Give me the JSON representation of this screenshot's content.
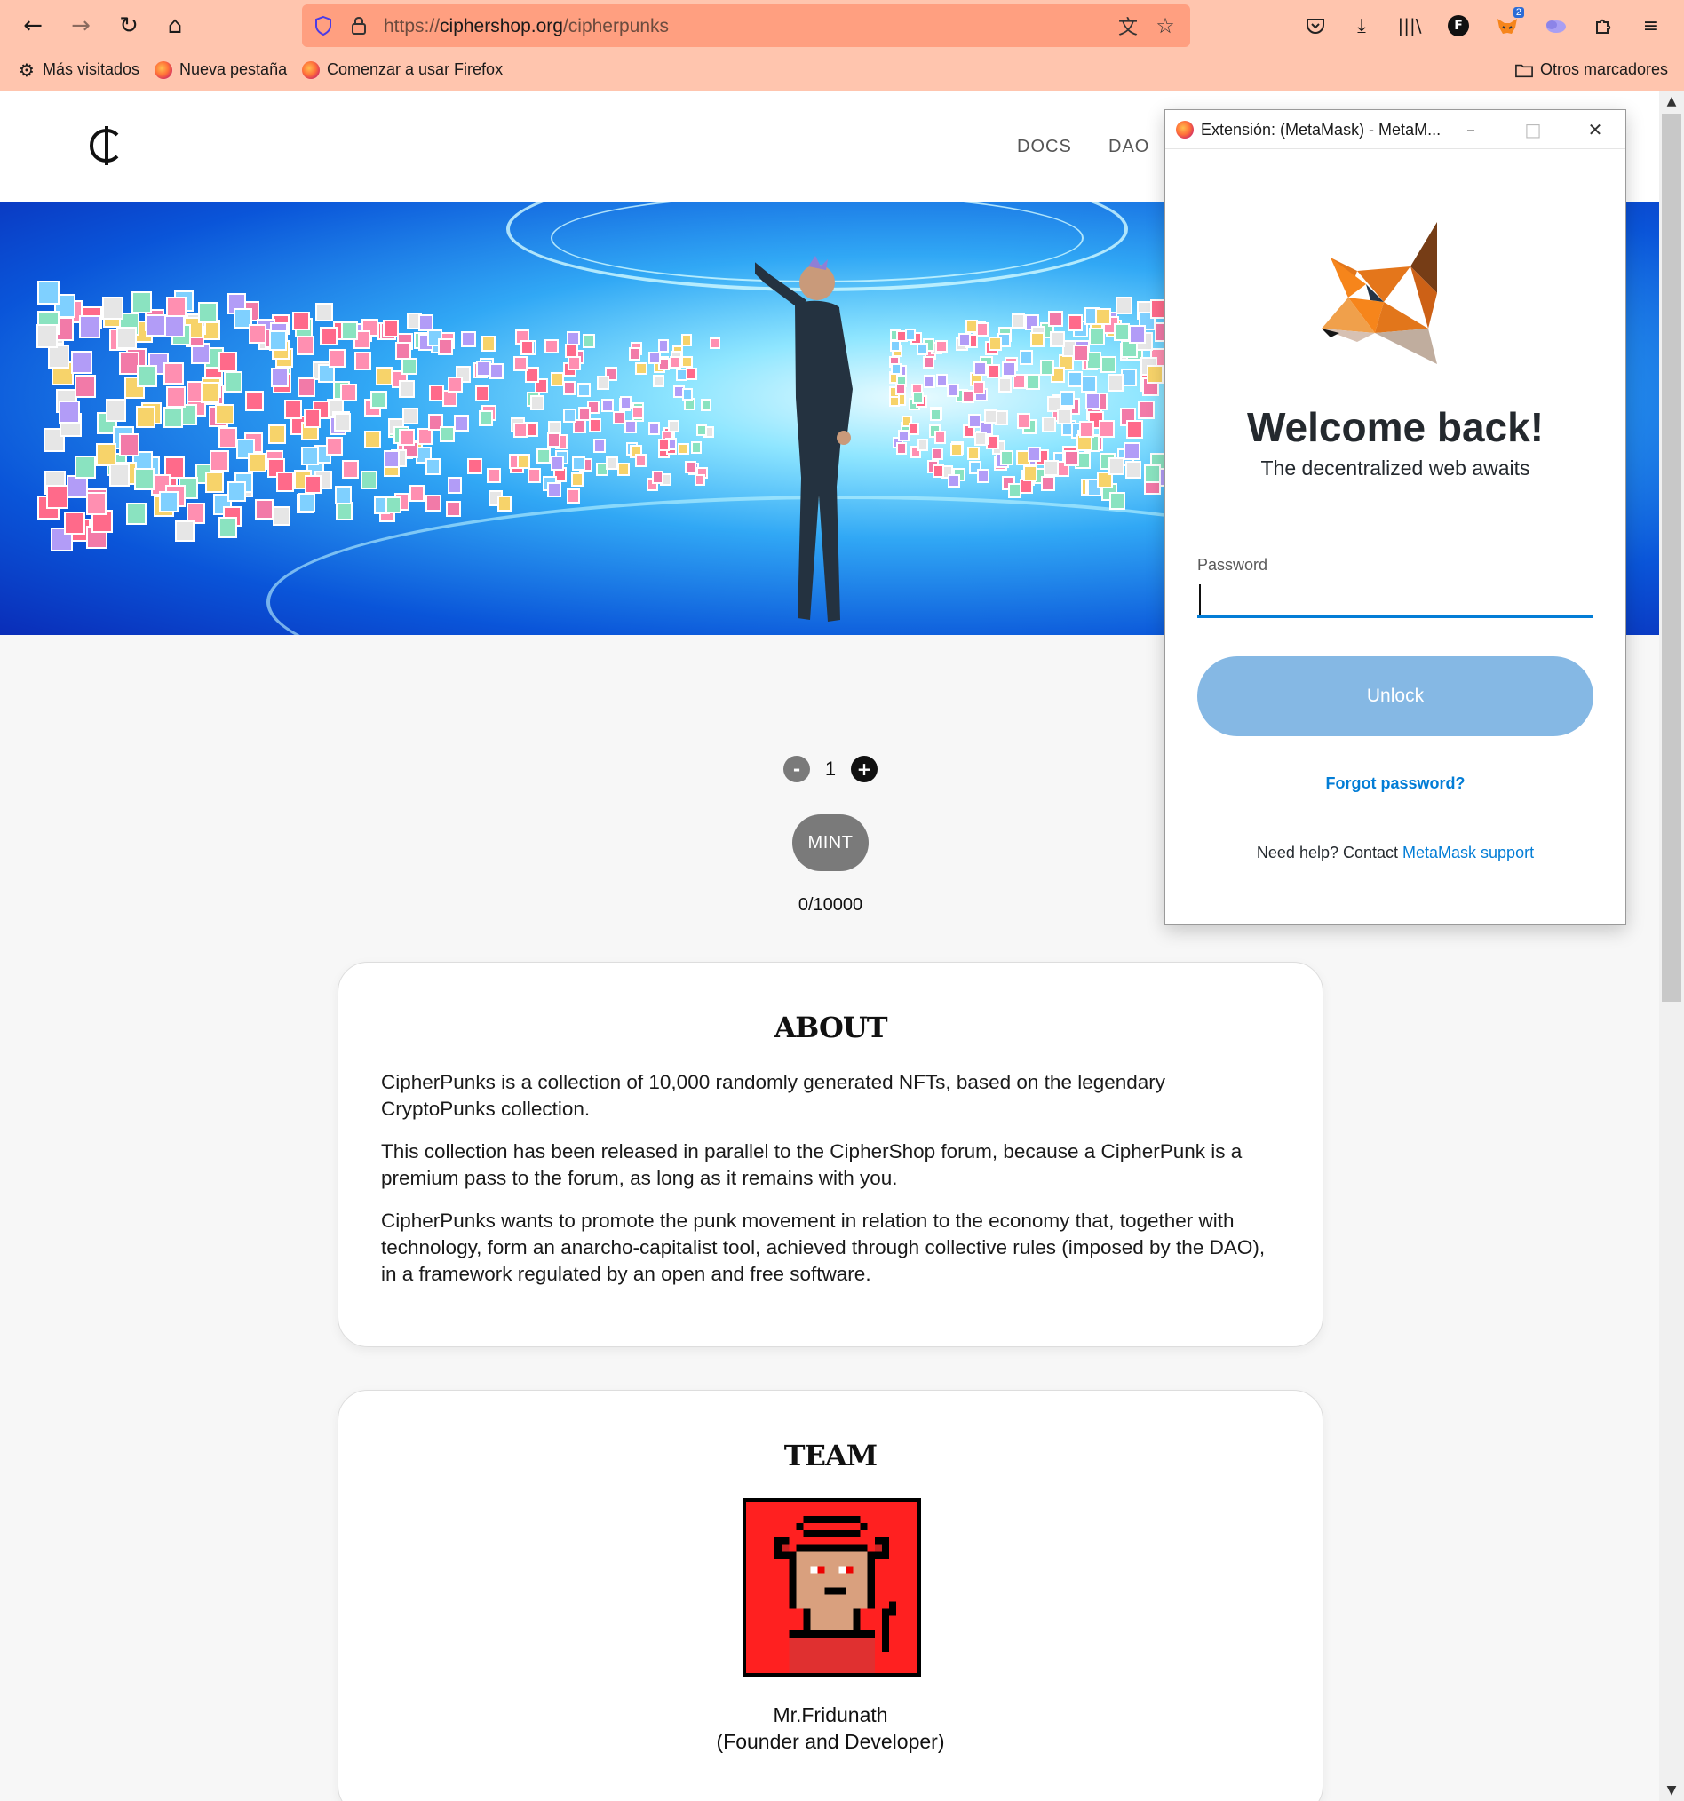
{
  "browser": {
    "url_prefix": "https://",
    "url_domain": "ciphershop.org",
    "url_path": "/cipherpunks",
    "extension_badge": "2",
    "profile_initial": "F",
    "bookmarks": [
      {
        "label": "Más visitados",
        "icon": "gear-icon"
      },
      {
        "label": "Nueva pestaña",
        "icon": "firefox-icon"
      },
      {
        "label": "Comenzar a usar Firefox",
        "icon": "firefox-icon"
      }
    ],
    "other_bookmarks": "Otros marcadores"
  },
  "site": {
    "nav": [
      "DOCS",
      "DAO"
    ],
    "mint": {
      "minus": "-",
      "quantity": "1",
      "plus": "+",
      "button": "MINT",
      "supply": "0/10000"
    },
    "about": {
      "title": "ABOUT",
      "paragraphs": [
        "CipherPunks is a collection of 10,000 randomly generated NFTs, based on the legendary CryptoPunks collection.",
        "This collection has been released in parallel to the CipherShop forum, because a CipherPunk is a premium pass to the forum, as long as it remains with you.",
        "CipherPunks wants to promote the punk movement in relation to the economy that, together with technology, form an anarcho-capitalist tool, achieved through collective rules (imposed by the DAO), in a framework regulated by an open and free software."
      ]
    },
    "team": {
      "title": "TEAM",
      "member_name": "Mr.Fridunath",
      "member_role": "(Founder and Developer)"
    }
  },
  "metamask": {
    "window_title": "Extensión: (MetaMask) - MetaM...",
    "welcome": "Welcome back!",
    "subtitle": "The decentralized web awaits",
    "password_label": "Password",
    "password_value": "",
    "unlock": "Unlock",
    "forgot": "Forgot password?",
    "help_prefix": "Need help? Contact ",
    "help_link": "MetaMask support"
  },
  "colors": {
    "chrome_bg": "#ffc5ae",
    "urlbar_bg": "#ff9f80",
    "metamask_blue": "#037dd6",
    "unlock_disabled": "#85b8e4",
    "mint_button": "#7a7a7a"
  }
}
